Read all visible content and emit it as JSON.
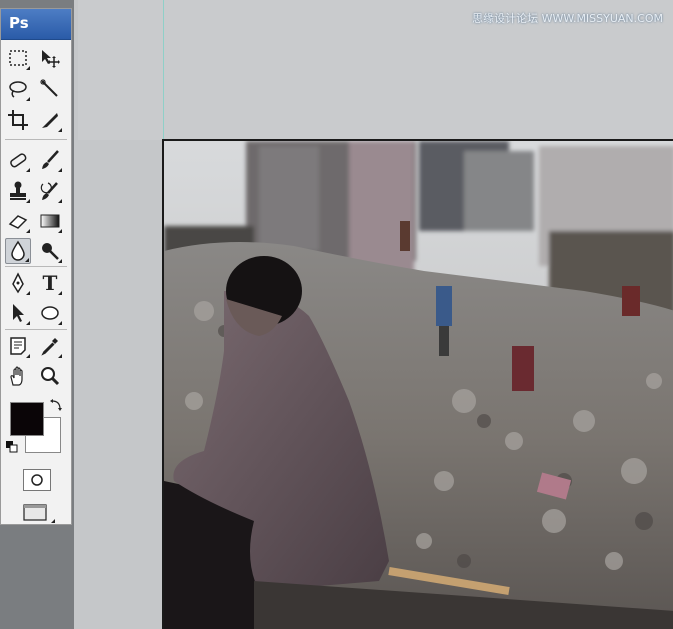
{
  "app": {
    "logo": "Ps"
  },
  "watermark": {
    "text": "思缘设计论坛 WWW.MISSYUAN.COM"
  },
  "toolbox": {
    "tools": [
      {
        "name": "marquee-tool-icon"
      },
      {
        "name": "move-tool-icon"
      },
      {
        "name": "lasso-tool-icon"
      },
      {
        "name": "magic-wand-tool-icon"
      },
      {
        "name": "crop-tool-icon"
      },
      {
        "name": "slice-tool-icon"
      },
      {
        "name": "healing-brush-tool-icon"
      },
      {
        "name": "brush-tool-icon"
      },
      {
        "name": "clone-stamp-tool-icon"
      },
      {
        "name": "history-brush-tool-icon"
      },
      {
        "name": "eraser-tool-icon"
      },
      {
        "name": "gradient-tool-icon"
      },
      {
        "name": "blur-tool-icon"
      },
      {
        "name": "dodge-tool-icon"
      },
      {
        "name": "pen-tool-icon"
      },
      {
        "name": "type-tool-icon",
        "glyph": "T"
      },
      {
        "name": "path-selection-tool-icon"
      },
      {
        "name": "ellipse-tool-icon"
      },
      {
        "name": "notes-tool-icon"
      },
      {
        "name": "eyedropper-tool-icon"
      },
      {
        "name": "hand-tool-icon"
      },
      {
        "name": "zoom-tool-icon"
      }
    ],
    "selected_tool": "blur-tool-icon",
    "foreground_color": "#0a0507",
    "background_color": "#ffffff"
  },
  "colors": {
    "header_blue": "#2a5ba8",
    "workspace_gray": "#c9cbcd",
    "guide_cyan": "#8fd0c8"
  }
}
